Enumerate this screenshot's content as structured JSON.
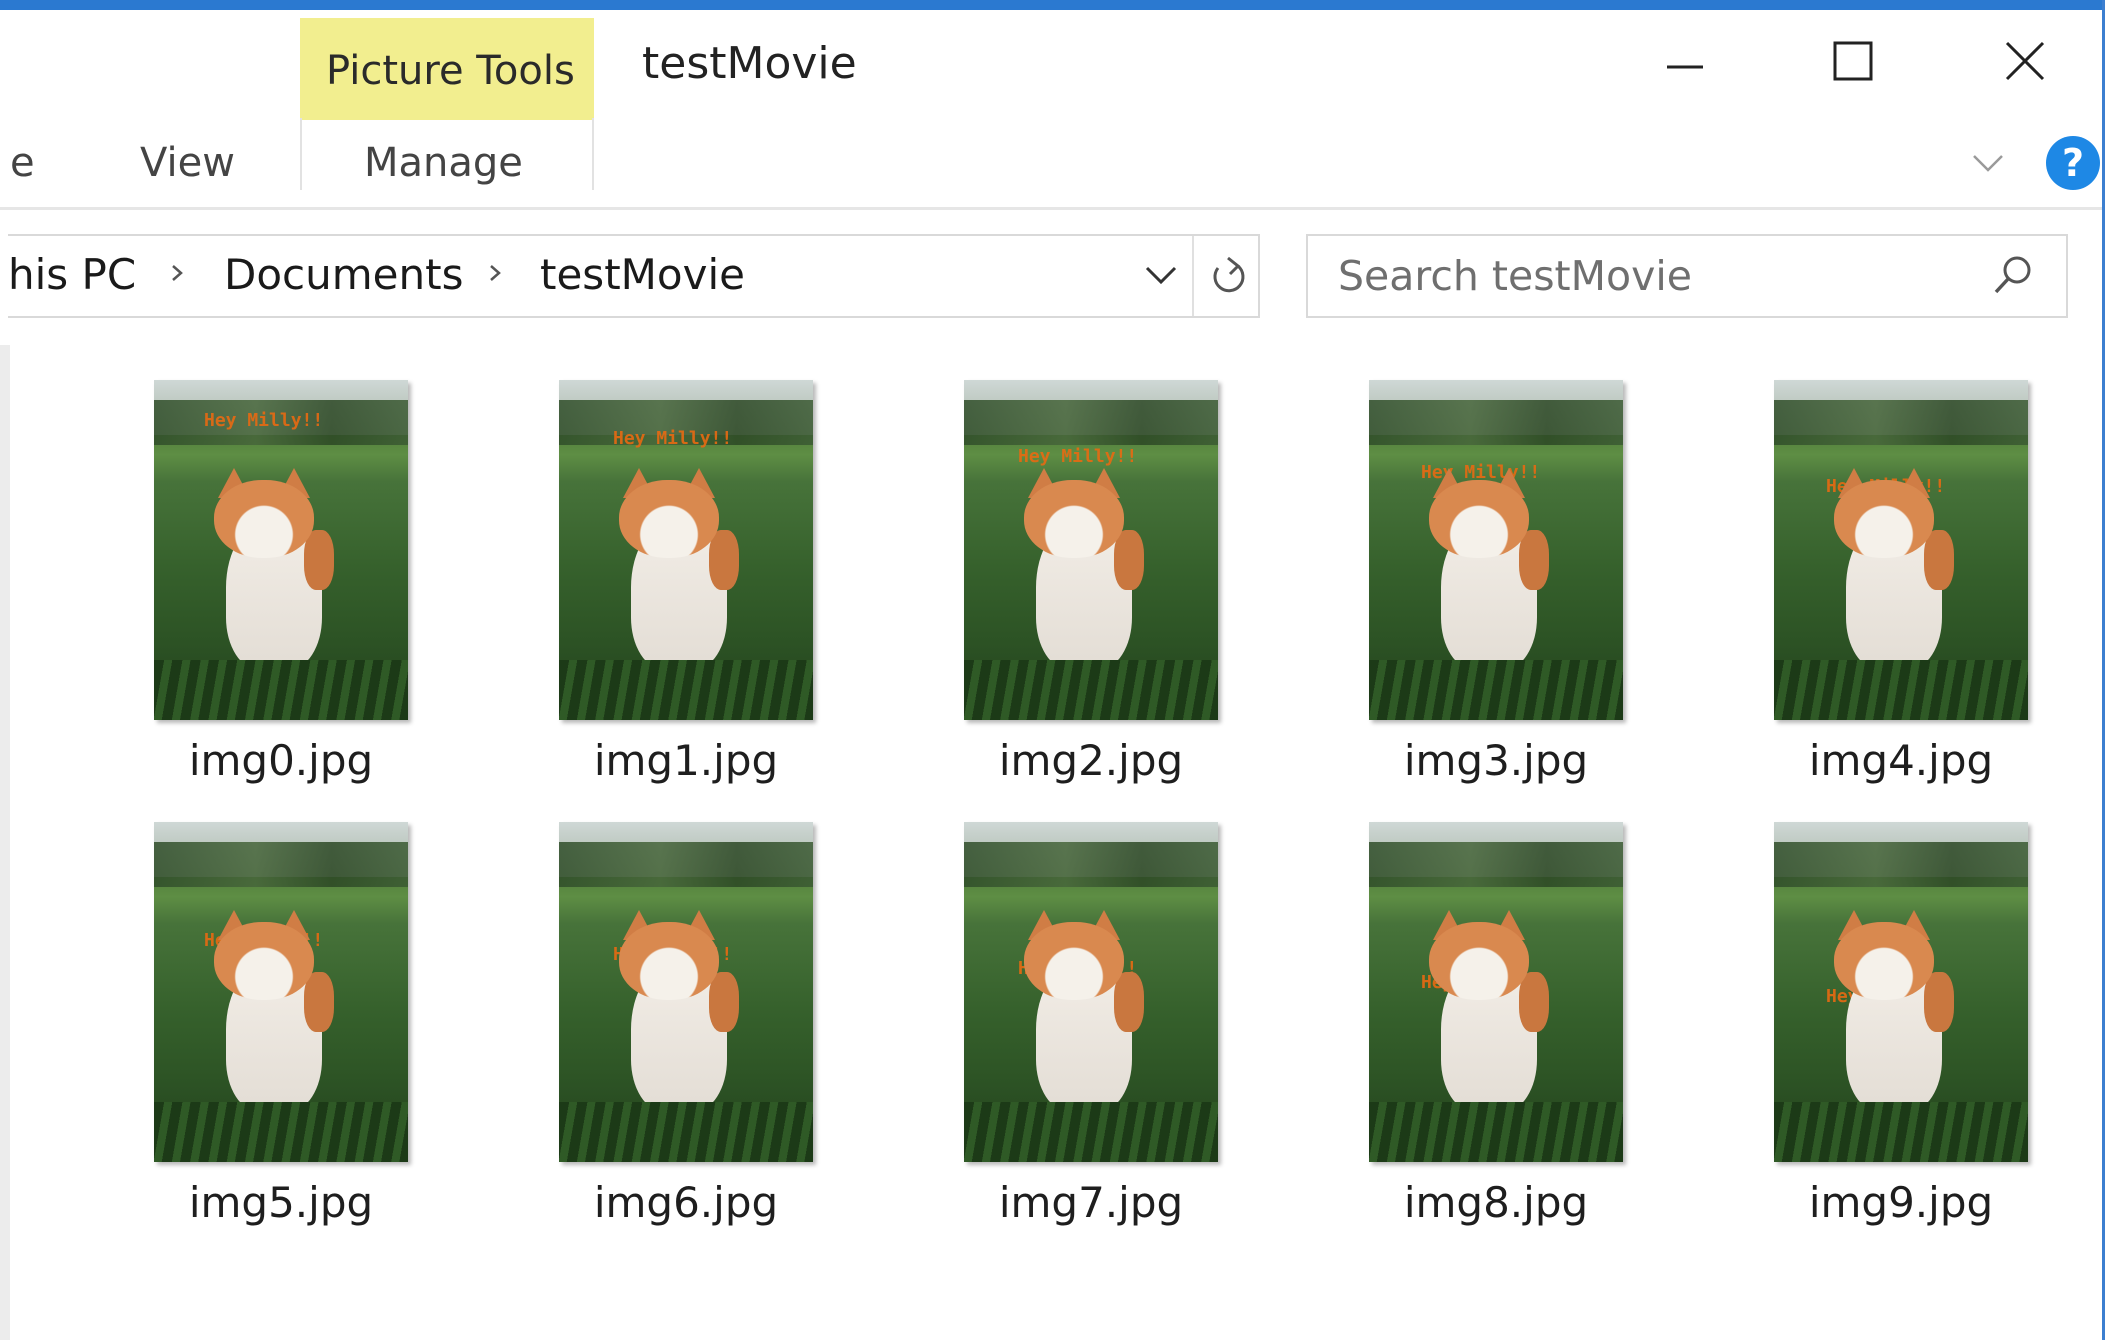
{
  "window": {
    "contextual_tab": "Picture Tools",
    "title": "testMovie"
  },
  "ribbon": {
    "tabs": [
      {
        "label": "e"
      },
      {
        "label": "View"
      },
      {
        "label": "Manage"
      }
    ]
  },
  "address": {
    "crumbs": [
      "his PC",
      "Documents",
      "testMovie"
    ]
  },
  "search": {
    "placeholder": "Search testMovie"
  },
  "thumbnail_overlay_text": "Hey Milly!!",
  "files": [
    {
      "name": "img0.jpg"
    },
    {
      "name": "img1.jpg"
    },
    {
      "name": "img2.jpg"
    },
    {
      "name": "img3.jpg"
    },
    {
      "name": "img4.jpg"
    },
    {
      "name": "img5.jpg"
    },
    {
      "name": "img6.jpg"
    },
    {
      "name": "img7.jpg"
    },
    {
      "name": "img8.jpg"
    },
    {
      "name": "img9.jpg"
    }
  ],
  "colors": {
    "contextual_tab_bg": "#f2ee8f",
    "frame_accent": "#2b79d0",
    "help_button": "#1e88e5",
    "thumbnail_text": "#e86a12"
  },
  "icons": [
    "minimize-icon",
    "maximize-icon",
    "close-icon",
    "ribbon-expand-icon",
    "help-icon",
    "breadcrumb-separator-icon",
    "address-dropdown-icon",
    "refresh-icon",
    "search-icon"
  ]
}
